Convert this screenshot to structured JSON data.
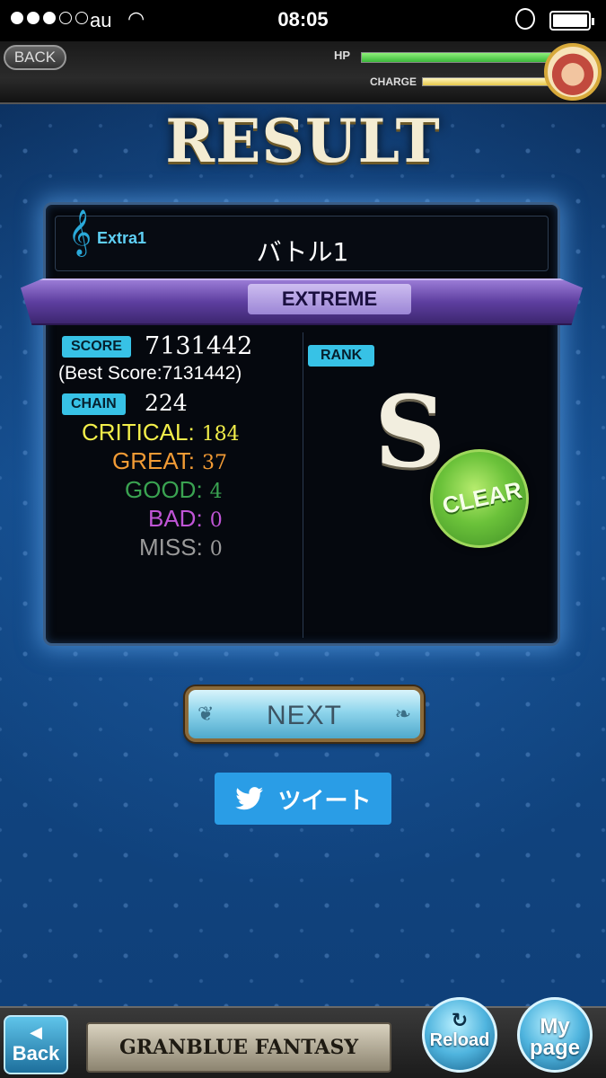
{
  "status_bar": {
    "carrier": "au",
    "time": "08:05"
  },
  "top_bar": {
    "back_label": "BACK",
    "hp_label": "HP",
    "charge_label": "CHARGE",
    "hp_level": 1.0,
    "charge_level": 1.0
  },
  "title": "RESULT",
  "song": {
    "extra_label": "Extra1",
    "title": "バトル1",
    "difficulty": "EXTREME"
  },
  "score": {
    "label": "SCORE",
    "value": "7131442",
    "best": "(Best Score:7131442)"
  },
  "chain": {
    "label": "CHAIN",
    "value": "224"
  },
  "stats": {
    "critical": {
      "label": "CRITICAL:",
      "value": "184",
      "color": "#f2ee4a"
    },
    "great": {
      "label": "GREAT:",
      "value": "37",
      "color": "#f29b35"
    },
    "good": {
      "label": "GOOD:",
      "value": "4",
      "color": "#3aa351"
    },
    "bad": {
      "label": "BAD:",
      "value": "0",
      "color": "#c055d6"
    },
    "miss": {
      "label": "MISS:",
      "value": "0",
      "color": "#9a9a9a"
    }
  },
  "rank": {
    "label": "RANK",
    "letter": "S",
    "clear_label": "CLEAR"
  },
  "buttons": {
    "next": "NEXT",
    "tweet": "ツイート"
  },
  "bottom_bar": {
    "back": "Back",
    "logo": "GRANBLUE FANTASY",
    "reload": "Reload",
    "mypage": "My page"
  }
}
